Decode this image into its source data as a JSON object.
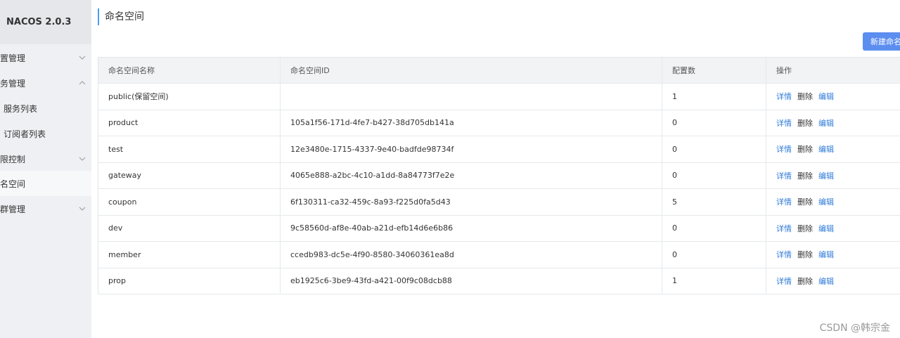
{
  "brand": "NACOS 2.0.3",
  "sidebar": {
    "items": [
      {
        "label": "置管理",
        "chevron": "chevron-down-icon"
      },
      {
        "label": "务管理",
        "chevron": "chevron-up-icon"
      },
      {
        "label": "服务列表"
      },
      {
        "label": "订阅者列表"
      },
      {
        "label": "限控制",
        "chevron": "chevron-down-icon"
      },
      {
        "label": "名空间"
      },
      {
        "label": "群管理",
        "chevron": "chevron-down-icon"
      }
    ]
  },
  "page_title": "命名空间",
  "new_button": "新建命名",
  "table": {
    "headers": [
      "命名空间名称",
      "命名空间ID",
      "配置数",
      "操作"
    ],
    "rows": [
      {
        "name": "public(保留空间)",
        "id": "",
        "count": "1"
      },
      {
        "name": "product",
        "id": "105a1f56-171d-4fe7-b427-38d705db141a",
        "count": "0"
      },
      {
        "name": "test",
        "id": "12e3480e-1715-4337-9e40-badfde98734f",
        "count": "0"
      },
      {
        "name": "gateway",
        "id": "4065e888-a2bc-4c10-a1dd-8a84773f7e2e",
        "count": "0"
      },
      {
        "name": "coupon",
        "id": "6f130311-ca32-459c-8a93-f225d0fa5d43",
        "count": "5"
      },
      {
        "name": "dev",
        "id": "9c58560d-af8e-40ab-a21d-efb14d6e6b86",
        "count": "0"
      },
      {
        "name": "member",
        "id": "ccedb983-dc5e-4f90-8580-34060361ea8d",
        "count": "0"
      },
      {
        "name": "prop",
        "id": "eb1925c6-3be9-43fd-a421-00f9c08dcb88",
        "count": "1"
      }
    ],
    "actions": {
      "detail": "详情",
      "delete": "删除",
      "edit": "编辑"
    }
  },
  "watermark": "CSDN @韩宗金",
  "colors": {
    "accent": "#5c8ef0",
    "link": "#2f7bd8",
    "sidebar_bg": "#eef0f3"
  }
}
